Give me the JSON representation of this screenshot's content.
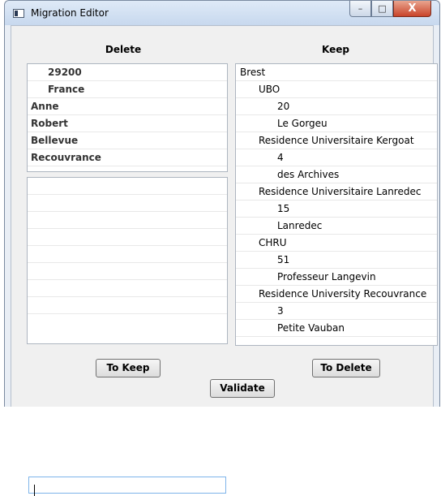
{
  "window": {
    "title": "Migration Editor",
    "icon": "app-window-icon",
    "controls": {
      "minimize": "–",
      "maximize": "□",
      "close": "X"
    }
  },
  "delete_panel": {
    "header": "Delete",
    "items": [
      {
        "label": "29200",
        "indent": 1
      },
      {
        "label": "France",
        "indent": 1
      },
      {
        "label": "Anne",
        "indent": 0
      },
      {
        "label": "Robert",
        "indent": 0
      },
      {
        "label": "Bellevue",
        "indent": 0
      },
      {
        "label": "Recouvrance",
        "indent": 0
      }
    ],
    "editor_input_value": ""
  },
  "keep_panel": {
    "header": "Keep",
    "tree": [
      {
        "label": "Brest",
        "level": 0
      },
      {
        "label": "UBO",
        "level": 1
      },
      {
        "label": "20",
        "level": 2
      },
      {
        "label": "Le Gorgeu",
        "level": 2
      },
      {
        "label": "Residence Universitaire Kergoat",
        "level": 1
      },
      {
        "label": "4",
        "level": 2
      },
      {
        "label": "des Archives",
        "level": 2
      },
      {
        "label": "Residence Universitaire Lanredec",
        "level": 1
      },
      {
        "label": "15",
        "level": 2
      },
      {
        "label": "Lanredec",
        "level": 2
      },
      {
        "label": "CHRU",
        "level": 1
      },
      {
        "label": "51",
        "level": 2
      },
      {
        "label": "Professeur Langevin",
        "level": 2
      },
      {
        "label": "Residence University Recouvrance",
        "level": 1
      },
      {
        "label": "3",
        "level": 2
      },
      {
        "label": "Petite Vauban",
        "level": 2
      }
    ]
  },
  "buttons": {
    "to_keep": "To Keep",
    "to_delete": "To Delete",
    "validate": "Validate"
  }
}
